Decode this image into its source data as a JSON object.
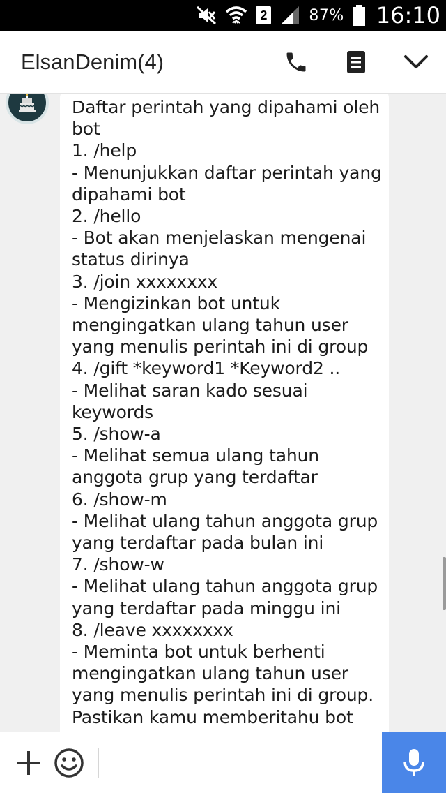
{
  "status_bar": {
    "sim_slot": "2",
    "battery_percent": "87%",
    "time": "16:10",
    "icons": [
      "mute-icon",
      "wifi-icon",
      "sim-icon",
      "signal-icon",
      "battery-icon"
    ]
  },
  "header": {
    "title": "ElsanDenim(4)",
    "icons": [
      "phone-icon",
      "menu-icon",
      "chevron-down-icon"
    ]
  },
  "message": {
    "lines": [
      "Daftar perintah yang dipahami oleh",
      "bot",
      "1. /help",
      "- Menunjukkan daftar perintah yang",
      "dipahami bot",
      "2. /hello",
      "- Bot akan menjelaskan mengenai",
      "status dirinya",
      "3. /join xxxxxxxx",
      "- Mengizinkan bot untuk",
      "mengingatkan ulang tahun user",
      "yang menulis perintah ini di group",
      "4. /gift *keyword1 *Keyword2 ..",
      "- Melihat saran kado sesuai",
      "keywords",
      "5. /show-a",
      "- Melihat semua ulang tahun",
      "anggota grup yang terdaftar",
      "6. /show-m",
      "- Melihat ulang tahun anggota grup",
      "yang terdaftar pada bulan ini",
      "7. /show-w",
      "- Melihat ulang tahun anggota grup",
      "yang terdaftar pada minggu ini",
      "8. /leave xxxxxxxx",
      "- Meminta bot untuk berhenti",
      "mengingatkan ulang tahun user",
      "yang menulis perintah ini di group.",
      "Pastikan kamu memberitahu bot"
    ]
  },
  "input_bar": {
    "placeholder": "",
    "icons": [
      "plus-icon",
      "emoji-icon",
      "microphone-icon"
    ],
    "mic_color": "#4a86e8"
  },
  "colors": {
    "status_bar_bg": "#000000",
    "chat_bg": "#f0f0f0",
    "bubble_bg": "#ffffff",
    "avatar_bg": "#1e3940"
  }
}
